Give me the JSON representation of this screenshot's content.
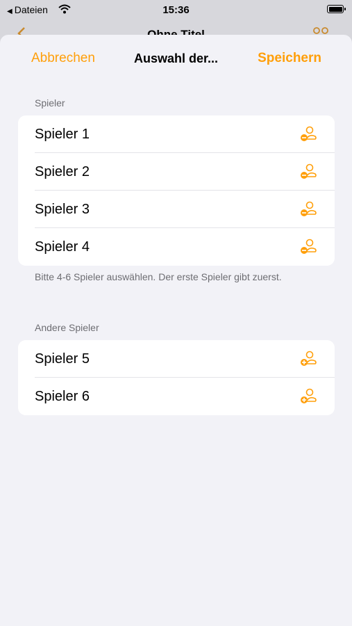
{
  "status_bar": {
    "back_app": "Dateien",
    "time": "15:36"
  },
  "background_screen": {
    "title": "Ohne Titel"
  },
  "nav": {
    "cancel": "Abbrechen",
    "title": "Auswahl der...",
    "save": "Speichern"
  },
  "selected_section": {
    "header": "Spieler",
    "players": [
      "Spieler 1",
      "Spieler 2",
      "Spieler 3",
      "Spieler 4"
    ],
    "footer": "Bitte 4-6 Spieler auswählen. Der erste Spieler gibt zuerst.",
    "icon": "person-minus-icon"
  },
  "other_section": {
    "header": "Andere Spieler",
    "players": [
      "Spieler 5",
      "Spieler 6"
    ],
    "icon": "person-plus-icon"
  },
  "colors": {
    "accent": "#ff9f0a",
    "background": "#f2f2f7"
  }
}
